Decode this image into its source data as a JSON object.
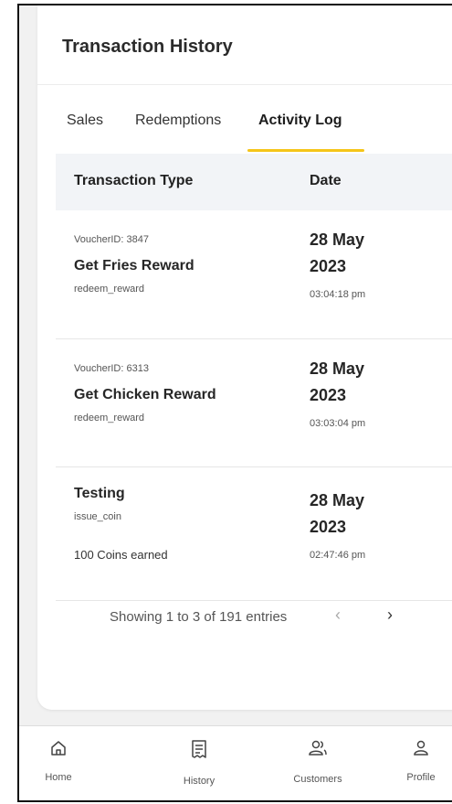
{
  "header": {
    "title": "Transaction History"
  },
  "tabs": [
    {
      "label": "Sales"
    },
    {
      "label": "Redemptions"
    },
    {
      "label": "Activity Log",
      "active": true
    }
  ],
  "table": {
    "columns": [
      "Transaction Type",
      "Date"
    ],
    "rows": [
      {
        "voucher": "VoucherID: 3847",
        "name": "Get Fries Reward",
        "type": "redeem_reward",
        "note": "",
        "date_day": "28 May",
        "date_year": "2023",
        "time": "03:04:18 pm"
      },
      {
        "voucher": "VoucherID: 6313",
        "name": "Get Chicken Reward",
        "type": "redeem_reward",
        "note": "",
        "date_day": "28 May",
        "date_year": "2023",
        "time": "03:03:04 pm"
      },
      {
        "voucher": "",
        "name": "Testing",
        "type": "issue_coin",
        "note": "100 Coins earned",
        "date_day": "28 May",
        "date_year": "2023",
        "time": "02:47:46 pm"
      }
    ]
  },
  "pagination": {
    "text": "Showing 1 to 3 of 191 entries",
    "prev": "‹",
    "next": "›"
  },
  "nav": [
    {
      "label": "Home",
      "icon": "home-icon"
    },
    {
      "label": "History",
      "icon": "receipt-icon"
    },
    {
      "label": "Customers",
      "icon": "users-icon"
    },
    {
      "label": "Profile",
      "icon": "user-icon"
    }
  ],
  "colors": {
    "accent": "#f5c518",
    "header_bg": "#f2f4f7",
    "page_bg": "#f1f1f1"
  }
}
